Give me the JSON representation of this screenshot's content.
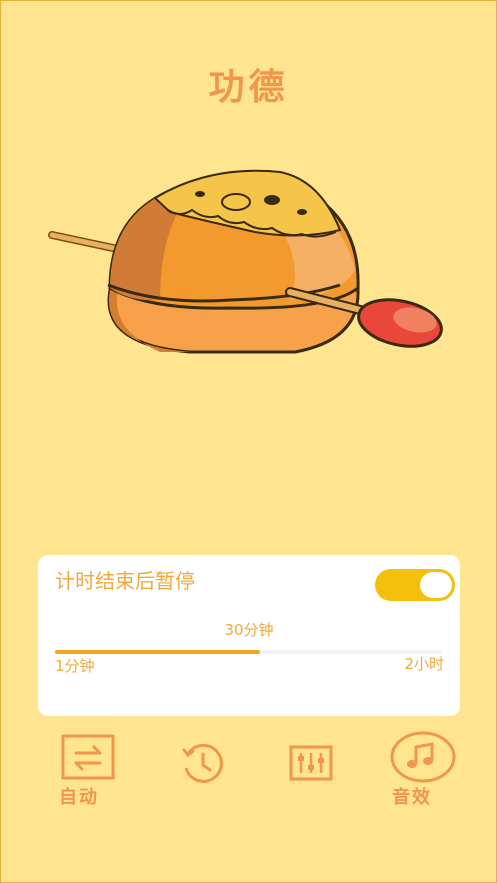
{
  "header": {
    "title": "功德"
  },
  "timer_card": {
    "title": "计时结束后暂停",
    "toggle_on": true,
    "current_value": "30分钟",
    "min_label": "1分钟",
    "max_label": "2小时",
    "slider_fraction": 0.53
  },
  "bottom_bar": {
    "auto_label": "自动",
    "sound_label": "音效"
  },
  "colors": {
    "background": "#FFE58F",
    "accent": "#F2964E",
    "toggle": "#F5C00A",
    "slider_fill": "#F5A623"
  },
  "icons": [
    "repeat-icon",
    "timer-icon",
    "equalizer-icon",
    "music-note-icon"
  ]
}
